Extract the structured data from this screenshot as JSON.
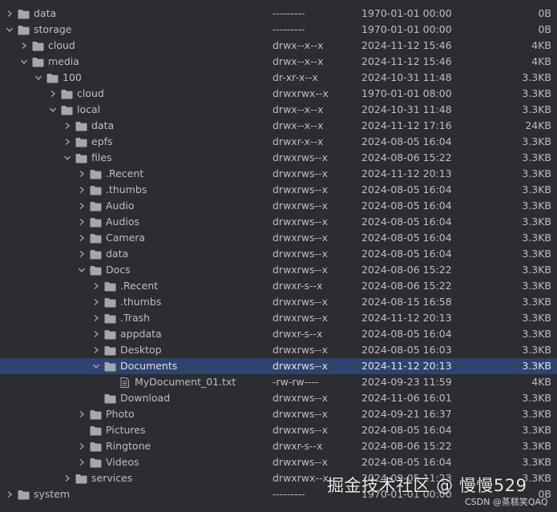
{
  "rows": [
    {
      "name": "data",
      "type": "folder",
      "depth": 0,
      "state": "collapsed",
      "perm": "---------",
      "date": "1970-01-01 00:00",
      "size": "0B"
    },
    {
      "name": "storage",
      "type": "folder",
      "depth": 0,
      "state": "expanded",
      "perm": "---------",
      "date": "1970-01-01 00:00",
      "size": "0B"
    },
    {
      "name": "cloud",
      "type": "folder",
      "depth": 1,
      "state": "collapsed",
      "perm": "drwx--x--x",
      "date": "2024-11-12 15:46",
      "size": "4KB"
    },
    {
      "name": "media",
      "type": "folder",
      "depth": 1,
      "state": "expanded",
      "perm": "drwx--x--x",
      "date": "2024-11-12 15:46",
      "size": "4KB"
    },
    {
      "name": "100",
      "type": "folder",
      "depth": 2,
      "state": "expanded",
      "perm": "dr-xr-x--x",
      "date": "2024-10-31 11:48",
      "size": "3.3KB"
    },
    {
      "name": "cloud",
      "type": "folder",
      "depth": 3,
      "state": "collapsed",
      "perm": "drwxrwx--x",
      "date": "1970-01-01 08:00",
      "size": "3.3KB"
    },
    {
      "name": "local",
      "type": "folder",
      "depth": 3,
      "state": "expanded",
      "perm": "drwx--x--x",
      "date": "2024-10-31 11:48",
      "size": "3.3KB"
    },
    {
      "name": "data",
      "type": "folder",
      "depth": 4,
      "state": "collapsed",
      "perm": "drwx--x--x",
      "date": "2024-11-12 17:16",
      "size": "24KB"
    },
    {
      "name": "epfs",
      "type": "folder",
      "depth": 4,
      "state": "collapsed",
      "perm": "drwxr-x--x",
      "date": "2024-08-05 16:04",
      "size": "3.3KB"
    },
    {
      "name": "files",
      "type": "folder",
      "depth": 4,
      "state": "expanded",
      "perm": "drwxrws--x",
      "date": "2024-08-06 15:22",
      "size": "3.3KB"
    },
    {
      "name": ".Recent",
      "type": "folder",
      "depth": 5,
      "state": "collapsed",
      "perm": "drwxrws--x",
      "date": "2024-11-12 20:13",
      "size": "3.3KB"
    },
    {
      "name": ".thumbs",
      "type": "folder",
      "depth": 5,
      "state": "collapsed",
      "perm": "drwxrws--x",
      "date": "2024-08-05 16:04",
      "size": "3.3KB"
    },
    {
      "name": "Audio",
      "type": "folder",
      "depth": 5,
      "state": "collapsed",
      "perm": "drwxrws--x",
      "date": "2024-08-05 16:04",
      "size": "3.3KB"
    },
    {
      "name": "Audios",
      "type": "folder",
      "depth": 5,
      "state": "collapsed",
      "perm": "drwxrws--x",
      "date": "2024-08-05 16:04",
      "size": "3.3KB"
    },
    {
      "name": "Camera",
      "type": "folder",
      "depth": 5,
      "state": "collapsed",
      "perm": "drwxrws--x",
      "date": "2024-08-05 16:04",
      "size": "3.3KB"
    },
    {
      "name": "data",
      "type": "folder",
      "depth": 5,
      "state": "collapsed",
      "perm": "drwxrws--x",
      "date": "2024-08-05 16:04",
      "size": "3.3KB"
    },
    {
      "name": "Docs",
      "type": "folder",
      "depth": 5,
      "state": "expanded",
      "perm": "drwxrws--x",
      "date": "2024-08-06 15:22",
      "size": "3.3KB"
    },
    {
      "name": ".Recent",
      "type": "folder",
      "depth": 6,
      "state": "collapsed",
      "perm": "drwxr-s--x",
      "date": "2024-08-06 15:22",
      "size": "3.3KB"
    },
    {
      "name": ".thumbs",
      "type": "folder",
      "depth": 6,
      "state": "collapsed",
      "perm": "drwxrws--x",
      "date": "2024-08-15 16:58",
      "size": "3.3KB"
    },
    {
      "name": ".Trash",
      "type": "folder",
      "depth": 6,
      "state": "collapsed",
      "perm": "drwxrws--x",
      "date": "2024-11-12 20:13",
      "size": "3.3KB"
    },
    {
      "name": "appdata",
      "type": "folder",
      "depth": 6,
      "state": "collapsed",
      "perm": "drwxr-s--x",
      "date": "2024-08-05 16:04",
      "size": "3.3KB"
    },
    {
      "name": "Desktop",
      "type": "folder",
      "depth": 6,
      "state": "collapsed",
      "perm": "drwxrws--x",
      "date": "2024-08-05 16:03",
      "size": "3.3KB"
    },
    {
      "name": "Documents",
      "type": "folder",
      "depth": 6,
      "state": "expanded",
      "selected": true,
      "perm": "drwxrws--x",
      "date": "2024-11-12 20:13",
      "size": "3.3KB"
    },
    {
      "name": "MyDocument_01.txt",
      "type": "file",
      "depth": 7,
      "state": "none",
      "perm": "-rw-rw----",
      "date": "2024-09-23 11:59",
      "size": "4KB"
    },
    {
      "name": "Download",
      "type": "folder",
      "depth": 6,
      "state": "none",
      "perm": "drwxrws--x",
      "date": "2024-11-06 16:01",
      "size": "3.3KB"
    },
    {
      "name": "Photo",
      "type": "folder",
      "depth": 5,
      "state": "collapsed",
      "perm": "drwxrws--x",
      "date": "2024-09-21 16:37",
      "size": "3.3KB"
    },
    {
      "name": "Pictures",
      "type": "folder",
      "depth": 5,
      "state": "none",
      "perm": "drwxrws--x",
      "date": "2024-08-05 16:04",
      "size": "3.3KB"
    },
    {
      "name": "Ringtone",
      "type": "folder",
      "depth": 5,
      "state": "collapsed",
      "perm": "drwxr-s--x",
      "date": "2024-08-06 15:22",
      "size": "3.3KB"
    },
    {
      "name": "Videos",
      "type": "folder",
      "depth": 5,
      "state": "collapsed",
      "perm": "drwxrws--x",
      "date": "2024-08-05 16:04",
      "size": "3.3KB"
    },
    {
      "name": "services",
      "type": "folder",
      "depth": 4,
      "state": "collapsed",
      "perm": "drwxrwx--x",
      "date": "2024-09-05 11:23",
      "size": "3.3KB"
    },
    {
      "name": "system",
      "type": "folder",
      "depth": 0,
      "state": "collapsed",
      "perm": "---------",
      "date": "1970-01-01 00:00",
      "size": "0B"
    }
  ],
  "watermark": {
    "text": "掘金技术社区 @ 慢慢529"
  },
  "csdn_tag": {
    "text": "CSDN @蒸糕笑QAQ"
  },
  "colors": {
    "background": "#2b2d30",
    "selection": "#2e436e",
    "folder": "#a4a7ad",
    "text": "#bcbec4"
  }
}
